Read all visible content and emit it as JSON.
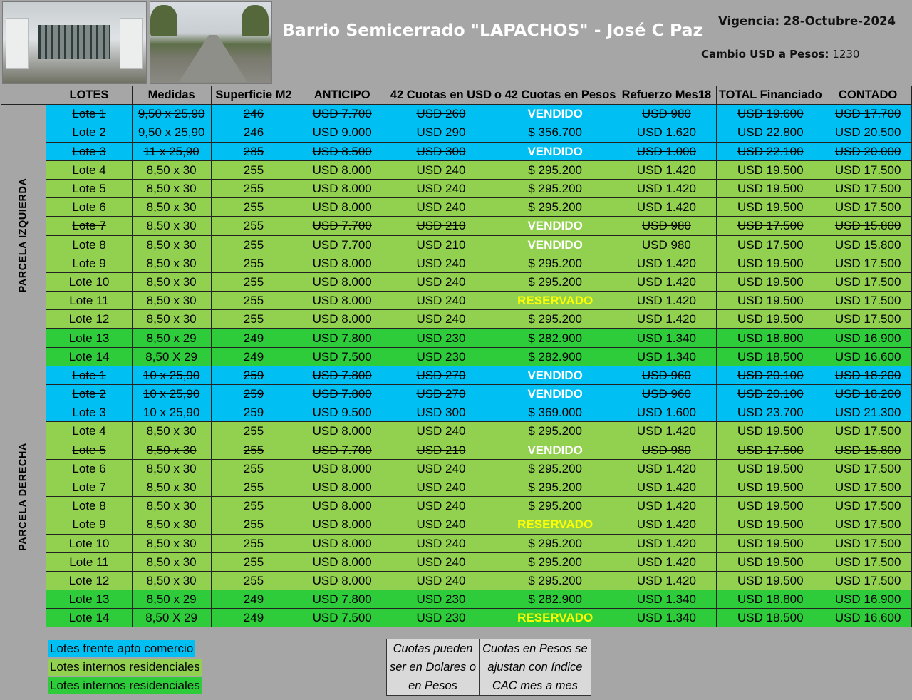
{
  "header": {
    "title": "Barrio Semicerrado \"LAPACHOS\" - José C Paz",
    "vigencia": "Vigencia: 28-Octubre-2024",
    "cambio_label": "Cambio USD a Pesos:",
    "cambio_value": "1230"
  },
  "columns": [
    "LOTES",
    "Medidas",
    "Superficie M2",
    "ANTICIPO",
    "42 Cuotas en USD",
    "o 42 Cuotas en Pesos",
    "Refuerzo Mes18",
    "TOTAL Financiado",
    "CONTADO"
  ],
  "parcels": [
    {
      "label": "PARCELA IZQUIERDA",
      "rows": [
        {
          "color": "blue",
          "sold": true,
          "cells": [
            "Lote 1",
            "9,50 x 25,90",
            "246",
            "USD 7.700",
            "USD 260",
            "VENDIDO",
            "USD 980",
            "USD 19.600",
            "USD 17.700"
          ]
        },
        {
          "color": "blue",
          "sold": false,
          "cells": [
            "Lote 2",
            "9,50 x 25,90",
            "246",
            "USD 9.000",
            "USD 290",
            "$ 356.700",
            "USD 1.620",
            "USD 22.800",
            "USD 20.500"
          ]
        },
        {
          "color": "blue",
          "sold": true,
          "cells": [
            "Lote 3",
            "11 x 25,90",
            "285",
            "USD 8.500",
            "USD 300",
            "VENDIDO",
            "USD 1.000",
            "USD 22.100",
            "USD 20.000"
          ]
        },
        {
          "color": "lgreen",
          "sold": false,
          "cells": [
            "Lote 4",
            "8,50 x 30",
            "255",
            "USD 8.000",
            "USD 240",
            "$ 295.200",
            "USD 1.420",
            "USD 19.500",
            "USD 17.500"
          ]
        },
        {
          "color": "lgreen",
          "sold": false,
          "cells": [
            "Lote 5",
            "8,50 x 30",
            "255",
            "USD 8.000",
            "USD 240",
            "$ 295.200",
            "USD 1.420",
            "USD 19.500",
            "USD 17.500"
          ]
        },
        {
          "color": "lgreen",
          "sold": false,
          "cells": [
            "Lote 6",
            "8,50 x 30",
            "255",
            "USD 8.000",
            "USD 240",
            "$ 295.200",
            "USD 1.420",
            "USD 19.500",
            "USD 17.500"
          ]
        },
        {
          "color": "lgreen",
          "sold": true,
          "partial": true,
          "cells": [
            "Lote 7",
            "8,50 x 30",
            "255",
            "USD 7.700",
            "USD 210",
            "VENDIDO",
            "USD 980",
            "USD 17.500",
            "USD 15.800"
          ]
        },
        {
          "color": "lgreen",
          "sold": true,
          "partial": true,
          "cells": [
            "Lote 8",
            "8,50 x 30",
            "255",
            "USD 7.700",
            "USD 210",
            "VENDIDO",
            "USD 980",
            "USD 17.500",
            "USD 15.800"
          ]
        },
        {
          "color": "lgreen",
          "sold": false,
          "cells": [
            "Lote 9",
            "8,50 x 30",
            "255",
            "USD 8.000",
            "USD 240",
            "$ 295.200",
            "USD 1.420",
            "USD 19.500",
            "USD 17.500"
          ]
        },
        {
          "color": "lgreen",
          "sold": false,
          "cells": [
            "Lote 10",
            "8,50 x 30",
            "255",
            "USD 8.000",
            "USD 240",
            "$ 295.200",
            "USD 1.420",
            "USD 19.500",
            "USD 17.500"
          ]
        },
        {
          "color": "lgreen",
          "sold": false,
          "cells": [
            "Lote 11",
            "8,50 x 30",
            "255",
            "USD 8.000",
            "USD 240",
            "RESERVADO",
            "USD 1.420",
            "USD 19.500",
            "USD 17.500"
          ]
        },
        {
          "color": "lgreen",
          "sold": false,
          "cells": [
            "Lote 12",
            "8,50 x 30",
            "255",
            "USD 8.000",
            "USD 240",
            "$ 295.200",
            "USD 1.420",
            "USD 19.500",
            "USD 17.500"
          ]
        },
        {
          "color": "dgreen",
          "sold": false,
          "cells": [
            "Lote 13",
            "8,50 x 29",
            "249",
            "USD 7.800",
            "USD 230",
            "$ 282.900",
            "USD 1.340",
            "USD 18.800",
            "USD 16.900"
          ]
        },
        {
          "color": "dgreen",
          "sold": false,
          "cells": [
            "Lote 14",
            "8,50 X 29",
            "249",
            "USD 7.500",
            "USD 230",
            "$ 282.900",
            "USD 1.340",
            "USD 18.500",
            "USD 16.600"
          ]
        }
      ]
    },
    {
      "label": "PARCELA DERECHA",
      "rows": [
        {
          "color": "blue",
          "sold": true,
          "cells": [
            "Lote 1",
            "10 x 25,90",
            "259",
            "USD 7.800",
            "USD 270",
            "VENDIDO",
            "USD 960",
            "USD 20.100",
            "USD 18.200"
          ]
        },
        {
          "color": "blue",
          "sold": true,
          "cells": [
            "Lote 2",
            "10 x 25,90",
            "259",
            "USD 7.800",
            "USD 270",
            "VENDIDO",
            "USD 960",
            "USD 20.100",
            "USD 18.200"
          ]
        },
        {
          "color": "blue",
          "sold": false,
          "cells": [
            "Lote 3",
            "10 x 25,90",
            "259",
            "USD 9.500",
            "USD 300",
            "$ 369.000",
            "USD 1.600",
            "USD 23.700",
            "USD 21.300"
          ]
        },
        {
          "color": "lgreen",
          "sold": false,
          "cells": [
            "Lote 4",
            "8,50 x 30",
            "255",
            "USD 8.000",
            "USD 240",
            "$ 295.200",
            "USD 1.420",
            "USD 19.500",
            "USD 17.500"
          ]
        },
        {
          "color": "lgreen",
          "sold": true,
          "cells": [
            "Lote 5",
            "8,50 x 30",
            "255",
            "USD 7.700",
            "USD 210",
            "VENDIDO",
            "USD 980",
            "USD 17.500",
            "USD 15.800"
          ]
        },
        {
          "color": "lgreen",
          "sold": false,
          "cells": [
            "Lote 6",
            "8,50 x 30",
            "255",
            "USD 8.000",
            "USD 240",
            "$ 295.200",
            "USD 1.420",
            "USD 19.500",
            "USD 17.500"
          ]
        },
        {
          "color": "lgreen",
          "sold": false,
          "cells": [
            "Lote 7",
            "8,50 x 30",
            "255",
            "USD 8.000",
            "USD 240",
            "$ 295.200",
            "USD 1.420",
            "USD 19.500",
            "USD 17.500"
          ]
        },
        {
          "color": "lgreen",
          "sold": false,
          "cells": [
            "Lote 8",
            "8,50 x 30",
            "255",
            "USD 8.000",
            "USD 240",
            "$ 295.200",
            "USD 1.420",
            "USD 19.500",
            "USD 17.500"
          ]
        },
        {
          "color": "lgreen",
          "sold": false,
          "cells": [
            "Lote 9",
            "8,50 x 30",
            "255",
            "USD 8.000",
            "USD 240",
            "RESERVADO",
            "USD 1.420",
            "USD 19.500",
            "USD 17.500"
          ]
        },
        {
          "color": "lgreen",
          "sold": false,
          "cells": [
            "Lote 10",
            "8,50 x 30",
            "255",
            "USD 8.000",
            "USD 240",
            "$ 295.200",
            "USD 1.420",
            "USD 19.500",
            "USD 17.500"
          ]
        },
        {
          "color": "lgreen",
          "sold": false,
          "cells": [
            "Lote 11",
            "8,50 x 30",
            "255",
            "USD 8.000",
            "USD 240",
            "$ 295.200",
            "USD 1.420",
            "USD 19.500",
            "USD 17.500"
          ]
        },
        {
          "color": "lgreen",
          "sold": false,
          "cells": [
            "Lote 12",
            "8,50 x 30",
            "255",
            "USD 8.000",
            "USD 240",
            "$ 295.200",
            "USD 1.420",
            "USD 19.500",
            "USD 17.500"
          ]
        },
        {
          "color": "dgreen",
          "sold": false,
          "cells": [
            "Lote 13",
            "8,50 x 29",
            "249",
            "USD 7.800",
            "USD 230",
            "$ 282.900",
            "USD 1.340",
            "USD 18.800",
            "USD 16.900"
          ]
        },
        {
          "color": "dgreen",
          "sold": false,
          "cells": [
            "Lote 14",
            "8,50 X 29",
            "249",
            "USD 7.500",
            "USD 230",
            "RESERVADO",
            "USD 1.340",
            "USD 18.500",
            "USD 16.600"
          ]
        }
      ]
    }
  ],
  "legend": [
    {
      "label": "Lotes frente apto comercio",
      "color": "#00c0f3"
    },
    {
      "label": "Lotes internos residenciales",
      "color": "#92d14f"
    },
    {
      "label": "Lotes internos residenciales",
      "color": "#2ecb3a"
    }
  ],
  "notes": [
    [
      "Cuotas pueden",
      "ser en Dolares o",
      "en Pesos"
    ],
    [
      "Cuotas en Pesos se",
      "ajustan con índice",
      "CAC mes a mes"
    ]
  ],
  "colors": {
    "blue": "#00c0f3",
    "light_green": "#92d14f",
    "dark_green": "#2ecb3a",
    "background": "#a6a6a6",
    "vendido": "#ffffff",
    "reservado": "#ffff00"
  }
}
